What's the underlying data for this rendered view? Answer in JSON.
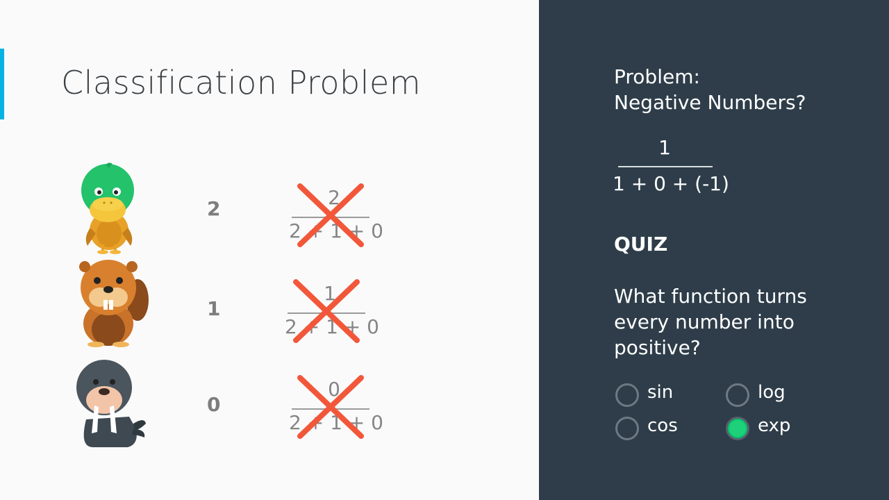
{
  "slide": {
    "title": "Classification Problem",
    "rows": [
      {
        "animal": "duck",
        "value": "2",
        "numerator": "2",
        "denominator": "2 + 1 + 0",
        "crossed": true
      },
      {
        "animal": "beaver",
        "value": "1",
        "numerator": "1",
        "denominator": "2 + 1 + 0",
        "crossed": true
      },
      {
        "animal": "walrus",
        "value": "0",
        "numerator": "0",
        "denominator": "2 + 1 + 0",
        "crossed": true
      }
    ]
  },
  "panel": {
    "problem_line1": "Problem:",
    "problem_line2": "Negative Numbers?",
    "fraction": {
      "numerator": "1",
      "denominator": "1 + 0 + (-1)"
    },
    "quiz_label": "QUIZ",
    "question": "What function turns every number into positive?",
    "options": [
      {
        "label": "sin",
        "selected": false
      },
      {
        "label": "log",
        "selected": false
      },
      {
        "label": "cos",
        "selected": false
      },
      {
        "label": "exp",
        "selected": true
      }
    ]
  },
  "colors": {
    "accent": "#02b3e4",
    "cross": "#f2573a",
    "panel_bg": "#2e3d49",
    "selected": "#1dd079"
  }
}
